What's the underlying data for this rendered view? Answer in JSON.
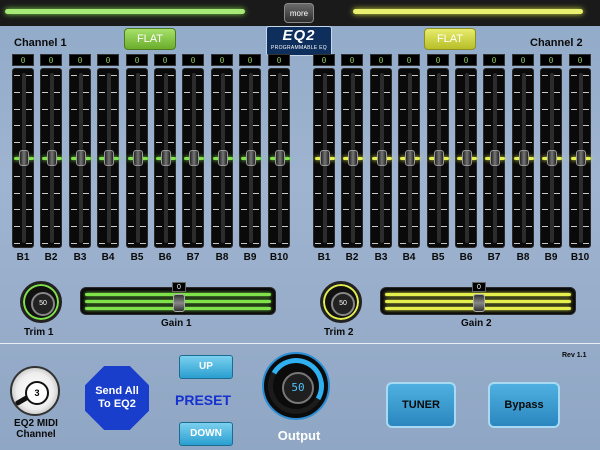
{
  "topbar": {
    "more_label": "more"
  },
  "header": {
    "channel1_label": "Channel 1",
    "channel2_label": "Channel 2",
    "flat1_label": "FLAT",
    "flat2_label": "FLAT",
    "logo_main": "EQ2",
    "logo_sub": "PROGRAMMABLE EQ"
  },
  "channel1": {
    "bands": [
      {
        "label": "B1",
        "value": "0"
      },
      {
        "label": "B2",
        "value": "0"
      },
      {
        "label": "B3",
        "value": "0"
      },
      {
        "label": "B4",
        "value": "0"
      },
      {
        "label": "B5",
        "value": "0"
      },
      {
        "label": "B6",
        "value": "0"
      },
      {
        "label": "B7",
        "value": "0"
      },
      {
        "label": "B8",
        "value": "0"
      },
      {
        "label": "B9",
        "value": "0"
      },
      {
        "label": "B10",
        "value": "0"
      }
    ],
    "trim": {
      "label": "Trim 1",
      "value": "50"
    },
    "gain": {
      "label": "Gain 1",
      "value": "0"
    }
  },
  "channel2": {
    "bands": [
      {
        "label": "B1",
        "value": "0"
      },
      {
        "label": "B2",
        "value": "0"
      },
      {
        "label": "B3",
        "value": "0"
      },
      {
        "label": "B4",
        "value": "0"
      },
      {
        "label": "B5",
        "value": "0"
      },
      {
        "label": "B6",
        "value": "0"
      },
      {
        "label": "B7",
        "value": "0"
      },
      {
        "label": "B8",
        "value": "0"
      },
      {
        "label": "B9",
        "value": "0"
      },
      {
        "label": "B10",
        "value": "0"
      }
    ],
    "trim": {
      "label": "Trim 2",
      "value": "50"
    },
    "gain": {
      "label": "Gain 2",
      "value": "0"
    }
  },
  "footer": {
    "rev": "Rev 1.1",
    "midi_value": "3",
    "midi_label_line1": "EQ2 MIDI",
    "midi_label_line2": "Channel",
    "send_line1": "Send All",
    "send_line2": "To EQ2",
    "up_label": "UP",
    "down_label": "DOWN",
    "preset_label": "PRESET",
    "output_value": "50",
    "output_label": "Output",
    "tuner_label": "TUNER",
    "bypass_label": "Bypass"
  },
  "colors": {
    "channel1_accent": "#7fe24a",
    "channel2_accent": "#e4ee4c",
    "output_accent": "#2fb0f0",
    "preset_text": "#1531d0"
  }
}
